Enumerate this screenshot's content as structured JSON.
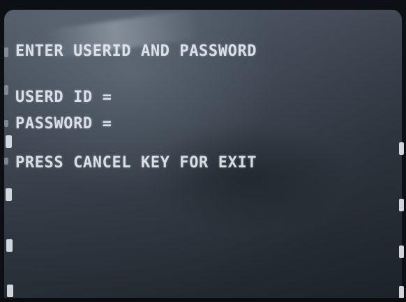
{
  "screen": {
    "line1": "ENTER USERID AND PASSWORD",
    "line2": "USERD ID =",
    "line3": "PASSWORD =",
    "line4": "PRESS CANCEL KEY FOR EXIT"
  },
  "colors": {
    "text": "#e6ecf2",
    "screen_background": "#3f4853",
    "bezel": "#0c0f13"
  }
}
